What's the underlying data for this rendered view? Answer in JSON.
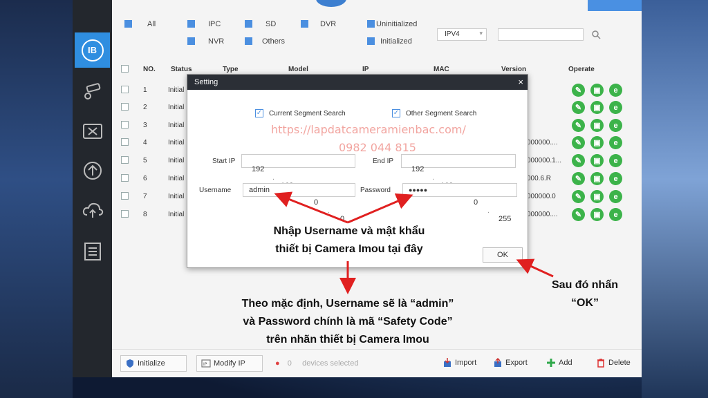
{
  "filters": {
    "all": "All",
    "ipc": "IPC",
    "sd": "SD",
    "dvr": "DVR",
    "nvr": "NVR",
    "others": "Others",
    "uninitialized": "Uninitialized",
    "initialized": "Initialized",
    "ip_version": "IPV4"
  },
  "table": {
    "headers": [
      "NO.",
      "Status",
      "Type",
      "Model",
      "IP",
      "MAC",
      "Version",
      "Operate"
    ],
    "rows": [
      {
        "no": "1",
        "status": "Initial",
        "version": ""
      },
      {
        "no": "2",
        "status": "Initial",
        "version": ""
      },
      {
        "no": "3",
        "status": "Initial",
        "version": ""
      },
      {
        "no": "4",
        "status": "Initial",
        "version": "000000...."
      },
      {
        "no": "5",
        "status": "Initial",
        "version": "000000.1..."
      },
      {
        "no": "6",
        "status": "Initial",
        "version": "000.6.R"
      },
      {
        "no": "7",
        "status": "Initial",
        "version": "000000.0"
      },
      {
        "no": "8",
        "status": "Initial",
        "version": "000000...."
      }
    ]
  },
  "dialog": {
    "title": "Setting",
    "close": "×",
    "current_segment": "Current Segment Search",
    "other_segment": "Other Segment Search",
    "start_ip_label": "Start IP",
    "start_ip": [
      "192",
      "168",
      "0",
      "0"
    ],
    "end_ip_label": "End IP",
    "end_ip": [
      "192",
      "168",
      "0",
      "255"
    ],
    "username_label": "Username",
    "username": "admin",
    "password_label": "Password",
    "password": "●●●●●",
    "ok": "OK"
  },
  "watermark": {
    "url": "https://lapdatcameramienbac.com/",
    "phone": "0982 044 815"
  },
  "annotations": {
    "center_line1": "Nhập Username và mật khẩu",
    "center_line2": "thiết bị Camera Imou tại đây",
    "bottom_line1": "Theo mặc định, Username sẽ là “admin”",
    "bottom_line2": "và Password chính là mã “Safety Code”",
    "bottom_line3": "trên nhãn thiết bị Camera Imou",
    "right_line1": "Sau đó nhấn",
    "right_line2": "“OK”"
  },
  "bottombar": {
    "initialize": "Initialize",
    "modify_ip": "Modify IP",
    "selected_count": "0",
    "devices_selected": "devices selected",
    "import": "Import",
    "export": "Export",
    "add": "Add",
    "delete": "Delete"
  },
  "colors": {
    "accent": "#2f8ee0",
    "sidebar": "#23272d",
    "op_green": "#3cb34a",
    "annotation_arrow": "#e02020"
  }
}
